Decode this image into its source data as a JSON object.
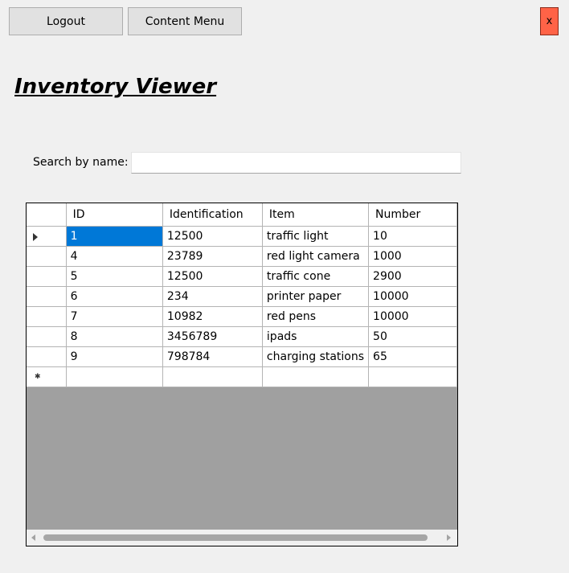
{
  "toolbar": {
    "logout_label": "Logout",
    "content_menu_label": "Content Menu",
    "close_label": "x"
  },
  "page": {
    "title": "Inventory Viewer"
  },
  "search": {
    "label": "Search by name:",
    "value": "",
    "placeholder": ""
  },
  "grid": {
    "columns": [
      "ID",
      "Identification",
      "Item",
      "Number"
    ],
    "rows": [
      [
        "1",
        "12500",
        "traffic light",
        "10"
      ],
      [
        "4",
        "23789",
        "red light camera",
        "1000"
      ],
      [
        "5",
        "12500",
        "traffic cone",
        "2900"
      ],
      [
        "6",
        "234",
        "printer paper",
        "10000"
      ],
      [
        "7",
        "10982",
        "red pens",
        "10000"
      ],
      [
        "8",
        "3456789",
        "ipads",
        "50"
      ],
      [
        "9",
        "798784",
        "charging stations",
        "65"
      ]
    ],
    "selected_row": 0,
    "selected_col": 0,
    "current_row_icon": "triangle-right-icon",
    "new_row_icon": "asterisk-icon"
  },
  "colors": {
    "close_button": "#ff6347",
    "selection": "#0078d7",
    "grid_background": "#a0a0a0"
  }
}
